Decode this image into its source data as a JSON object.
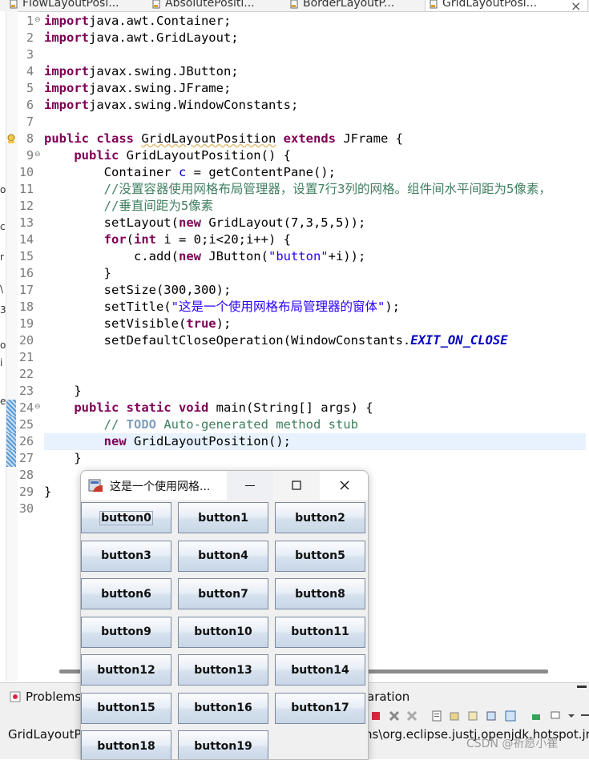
{
  "tabs": [
    {
      "label": "FlowLayoutPosi...",
      "active": false
    },
    {
      "label": "AbsolutePositi...",
      "active": false
    },
    {
      "label": "BorderLayoutP...",
      "active": false
    },
    {
      "label": "GridLayoutPosi...",
      "active": true
    }
  ],
  "tab_close": "×",
  "left_strip": [
    "o",
    "c",
    "r",
    "\\",
    "3",
    "o",
    "i",
    "e"
  ],
  "code_lines": [
    {
      "n": "1",
      "fold": "⊖",
      "tokens": [
        [
          "kw",
          "import"
        ],
        [
          "",
          "java.awt.Container;"
        ]
      ]
    },
    {
      "n": "2",
      "tokens": [
        [
          "kw",
          "import"
        ],
        [
          "",
          "java.awt.GridLayout;"
        ]
      ]
    },
    {
      "n": "3",
      "tokens": []
    },
    {
      "n": "4",
      "tokens": [
        [
          "kw",
          "import"
        ],
        [
          "",
          "javax.swing.JButton;"
        ]
      ]
    },
    {
      "n": "5",
      "tokens": [
        [
          "kw",
          "import"
        ],
        [
          "",
          "javax.swing.JFrame;"
        ]
      ]
    },
    {
      "n": "6",
      "tokens": [
        [
          "kw",
          "import"
        ],
        [
          "",
          "javax.swing.WindowConstants;"
        ]
      ]
    },
    {
      "n": "7",
      "tokens": []
    },
    {
      "n": "8",
      "warn": true,
      "tokens": [
        [
          "kw",
          "public class "
        ],
        [
          "squiggle",
          "GridLayoutPosition"
        ],
        [
          "",
          " "
        ],
        [
          "kw",
          "extends"
        ],
        [
          "",
          " JFrame {"
        ]
      ]
    },
    {
      "n": "9",
      "fold": "⊖",
      "tokens": [
        [
          "",
          "    "
        ],
        [
          "kw",
          "public"
        ],
        [
          "",
          " GridLayoutPosition() {"
        ]
      ]
    },
    {
      "n": "10",
      "tokens": [
        [
          "",
          "        Container "
        ],
        [
          "fld",
          "c"
        ],
        [
          "",
          " = getContentPane();"
        ]
      ]
    },
    {
      "n": "11",
      "tokens": [
        [
          "cm",
          "        //没置容器使用网格布局管理器，设置7行3列的网格。组件间水平间距为5像素，"
        ]
      ]
    },
    {
      "n": "12",
      "tokens": [
        [
          "cm",
          "        //垂直间距为5像素"
        ]
      ]
    },
    {
      "n": "13",
      "tokens": [
        [
          "",
          "        setLayout("
        ],
        [
          "kw",
          "new"
        ],
        [
          "",
          " GridLayout(7,3,5,5));"
        ]
      ]
    },
    {
      "n": "14",
      "tokens": [
        [
          "",
          "        "
        ],
        [
          "kw",
          "for"
        ],
        [
          "",
          "("
        ],
        [
          "kw",
          "int"
        ],
        [
          "",
          " i = 0;i<20;i++) {"
        ]
      ]
    },
    {
      "n": "15",
      "tokens": [
        [
          "",
          "            c.add("
        ],
        [
          "kw",
          "new"
        ],
        [
          "",
          " JButton("
        ],
        [
          "str",
          "\"button\""
        ],
        [
          "",
          "+i));"
        ]
      ]
    },
    {
      "n": "16",
      "tokens": [
        [
          "",
          "        }"
        ]
      ]
    },
    {
      "n": "17",
      "tokens": [
        [
          "",
          "        setSize(300,300);"
        ]
      ]
    },
    {
      "n": "18",
      "tokens": [
        [
          "",
          "        setTitle("
        ],
        [
          "str",
          "\"这是一个使用网格布局管理器的窗体\""
        ],
        [
          "",
          ");"
        ]
      ]
    },
    {
      "n": "19",
      "tokens": [
        [
          "",
          "        setVisible("
        ],
        [
          "kw",
          "true"
        ],
        [
          "",
          ");"
        ]
      ]
    },
    {
      "n": "20",
      "tokens": [
        [
          "",
          "        setDefaultCloseOperation(WindowConstants."
        ],
        [
          "cst",
          "EXIT_ON_CLOSE"
        ]
      ]
    },
    {
      "n": "21",
      "tokens": []
    },
    {
      "n": "22",
      "tokens": []
    },
    {
      "n": "23",
      "tokens": [
        [
          "",
          "    }"
        ]
      ]
    },
    {
      "n": "24",
      "fold": "⊖",
      "bp": true,
      "tokens": [
        [
          "",
          "    "
        ],
        [
          "kw",
          "public static void"
        ],
        [
          "",
          " main(String[] "
        ],
        [
          "",
          "args) {"
        ]
      ]
    },
    {
      "n": "25",
      "bp": true,
      "tokens": [
        [
          "cm",
          "        // "
        ],
        [
          "todo",
          "TODO"
        ],
        [
          "cm",
          " Auto-generated method stub"
        ]
      ]
    },
    {
      "n": "26",
      "bp": true,
      "hl": true,
      "tokens": [
        [
          "",
          "        "
        ],
        [
          "kw",
          "new"
        ],
        [
          "",
          " GridLayoutPosition();"
        ]
      ]
    },
    {
      "n": "27",
      "bp": true,
      "tokens": [
        [
          "",
          "    }"
        ]
      ]
    },
    {
      "n": "28",
      "tokens": []
    },
    {
      "n": "29",
      "tokens": [
        [
          "",
          "}"
        ]
      ]
    },
    {
      "n": "30",
      "tokens": []
    }
  ],
  "bottom_panel": {
    "tab_problems": "Problems",
    "tab_declaration": "aration",
    "status_left": "GridLayoutPo",
    "status_right": "ns\\org.eclipse.justj.openjdk.hotspot.jre"
  },
  "watermark": "CSDN @祈愿小崔",
  "window": {
    "title": "这是一个使用网格...",
    "minimize": "—",
    "buttons": [
      "button0",
      "button1",
      "button2",
      "button3",
      "button4",
      "button5",
      "button6",
      "button7",
      "button8",
      "button9",
      "button10",
      "button11",
      "button12",
      "button13",
      "button14",
      "button15",
      "button16",
      "button17",
      "button18",
      "button19"
    ]
  },
  "colors": {
    "keyword": "#7f0055",
    "comment": "#3f7f5f",
    "string": "#2a00ff",
    "field": "#0000c0",
    "current_line": "#e8f2fe"
  }
}
